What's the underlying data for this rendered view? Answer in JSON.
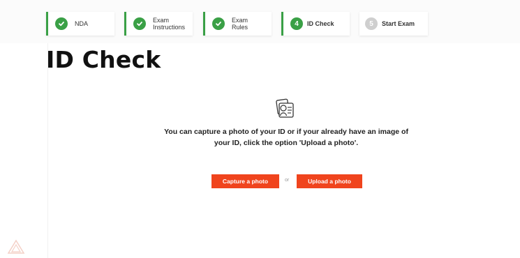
{
  "stepper": {
    "steps": [
      {
        "label": "NDA",
        "status": "done",
        "icon": "check-icon"
      },
      {
        "label": "Exam\nInstructions",
        "status": "done",
        "icon": "check-icon"
      },
      {
        "label": "Exam\nRules",
        "status": "done",
        "icon": "check-icon"
      },
      {
        "label": "ID Check",
        "status": "active",
        "number": "4"
      },
      {
        "label": "Start Exam",
        "status": "pending",
        "number": "5"
      }
    ]
  },
  "page": {
    "title": "ID Check",
    "instructions": "You can capture a photo of your ID or if your already have an image of your ID, click the option 'Upload a photo'.",
    "id_icon": "id-card-icon"
  },
  "actions": {
    "capture_label": "Capture a photo",
    "or_label": "or",
    "upload_label": "Upload a photo"
  },
  "colors": {
    "accent_green": "#3aa046",
    "button_orange": "#f0441d",
    "pending_grey": "#cfcfcf"
  }
}
